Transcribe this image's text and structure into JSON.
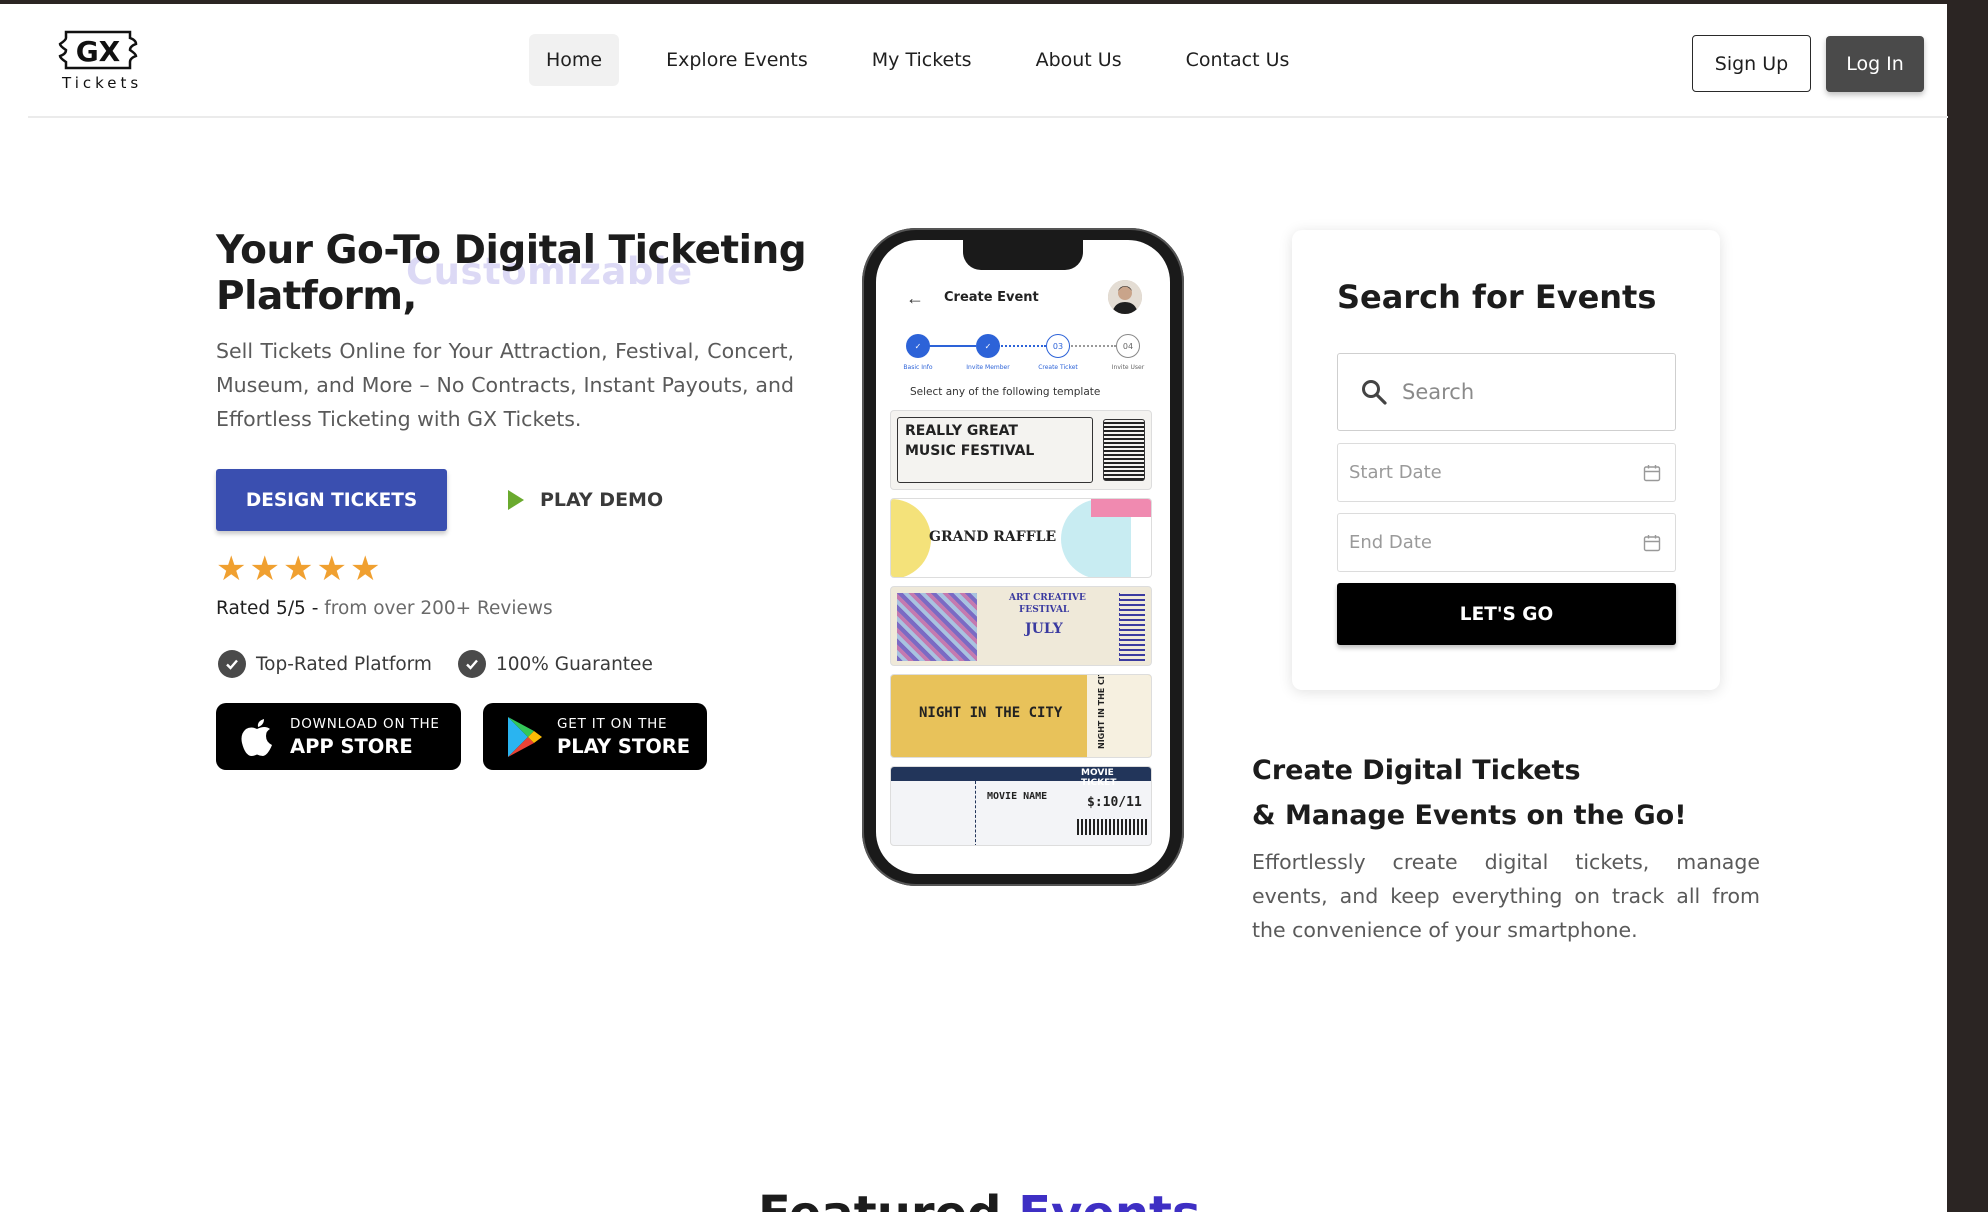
{
  "header": {
    "logo_mark": "GX",
    "logo_text": "Tickets",
    "nav": [
      {
        "label": "Home",
        "active": true
      },
      {
        "label": "Explore Events",
        "active": false
      },
      {
        "label": "My Tickets",
        "active": false
      },
      {
        "label": "About Us",
        "active": false
      },
      {
        "label": "Contact Us",
        "active": false
      }
    ],
    "signup_label": "Sign Up",
    "login_label": "Log In"
  },
  "hero": {
    "title_line1": "Your Go-To Digital Ticketing",
    "title_line2": "Platform,",
    "ghost_word": "Customizable",
    "subtitle": "Sell Tickets Online for Your Attraction, Festival, Concert, Museum, and More – No Contracts, Instant Payouts, and Effortless Ticketing with GX Tickets.",
    "design_button": "DESIGN TICKETS",
    "demo_button": "PLAY DEMO",
    "stars": 5,
    "rating_strong": "Rated 5/5 -",
    "rating_muted": "from over 200+ Reviews",
    "badges": [
      "Top-Rated Platform",
      "100% Guarantee"
    ],
    "app_store": {
      "small": "DOWNLOAD ON THE",
      "big": "APP STORE"
    },
    "play_store": {
      "small": "GET IT ON THE",
      "big": "PLAY STORE"
    }
  },
  "phone": {
    "screen_title": "Create Event",
    "steps": [
      {
        "label": "Basic Info",
        "num": ""
      },
      {
        "label": "Invite Member",
        "num": ""
      },
      {
        "label": "Create Ticket",
        "num": "03"
      },
      {
        "label": "Invite User",
        "num": "04"
      }
    ],
    "caption": "Select any of the following template",
    "tickets": [
      {
        "line1": "REALLY GREAT",
        "line2": "MUSIC FESTIVAL"
      },
      {
        "line1": "GRAND RAFFLE"
      },
      {
        "line1": "ART CREATIVE",
        "line2": "FESTIVAL",
        "line3": "JULY"
      },
      {
        "line1": "NIGHT IN THE CITY",
        "side": "NIGHT IN THE CITY"
      },
      {
        "line1": "MOVIE TICKET",
        "line2": "MOVIE NAME",
        "price": "$:10/11"
      }
    ]
  },
  "search": {
    "title": "Search for Events",
    "search_placeholder": "Search",
    "start_placeholder": "Start Date",
    "end_placeholder": "End Date",
    "go_button": "LET'S GO"
  },
  "promo": {
    "title_line1": "Create Digital Tickets",
    "title_line2": "& Manage Events on the Go!",
    "text": "Effortlessly create digital tickets, manage events, and keep everything on track all from the convenience of your smartphone."
  },
  "featured": {
    "word1": "Featured",
    "word2": "Events"
  },
  "colors": {
    "primary": "#3a4fb0",
    "accent": "#3e2fc4",
    "star": "#f0a030",
    "play": "#6aaa2e",
    "dark": "#2b2523"
  }
}
